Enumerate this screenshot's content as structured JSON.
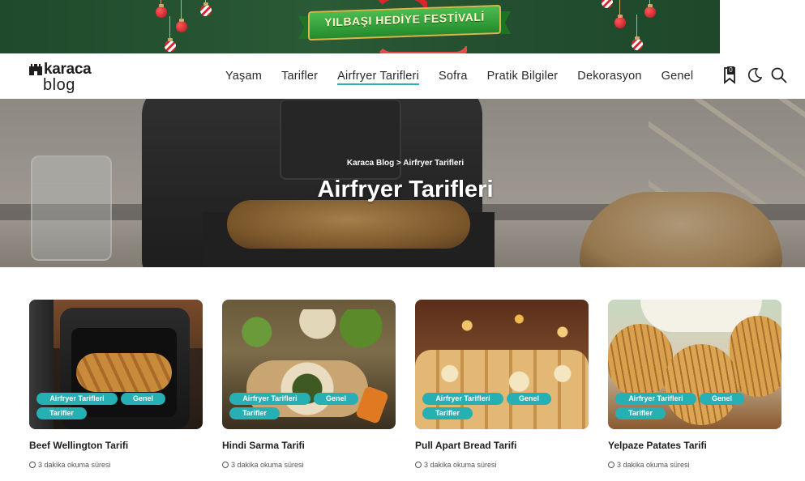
{
  "banner": {
    "text": "YILBAŞI HEDİYE FESTİVALİ"
  },
  "logo": {
    "top": "karaca",
    "bottom": "blog"
  },
  "menu": [
    {
      "label": "Yaşam"
    },
    {
      "label": "Tarifler"
    },
    {
      "label": "Airfryer Tarifleri",
      "active": true
    },
    {
      "label": "Sofra"
    },
    {
      "label": "Pratik Bilgiler"
    },
    {
      "label": "Dekorasyon"
    },
    {
      "label": "Genel"
    }
  ],
  "nav_icons": {
    "bookmark_icon": "bookmark-icon",
    "bookmark_count": "0",
    "theme_icon": "moon-icon",
    "search_icon": "search-icon"
  },
  "hero": {
    "breadcrumb": "Karaca Blog > Airfryer Tarifleri",
    "title": "Airfryer Tarifleri"
  },
  "cards": [
    {
      "title": "Beef Wellington Tarifi",
      "tags": [
        "Airfryer Tarifleri",
        "Genel",
        "Tarifler"
      ],
      "read_time": "3 dakika okuma süresi"
    },
    {
      "title": "Hindi Sarma Tarifi",
      "tags": [
        "Airfryer Tarifleri",
        "Genel",
        "Tarifler"
      ],
      "read_time": "3 dakika okuma süresi"
    },
    {
      "title": "Pull Apart Bread Tarifi",
      "tags": [
        "Airfryer Tarifleri",
        "Genel",
        "Tarifler"
      ],
      "read_time": "3 dakika okuma süresi"
    },
    {
      "title": "Yelpaze Patates Tarifi",
      "tags": [
        "Airfryer Tarifleri",
        "Genel",
        "Tarifler"
      ],
      "read_time": "3 dakika okuma süresi"
    }
  ],
  "colors": {
    "accent": "#27b0b4",
    "banner_green": "#244f30",
    "text": "#1e1e1e"
  }
}
